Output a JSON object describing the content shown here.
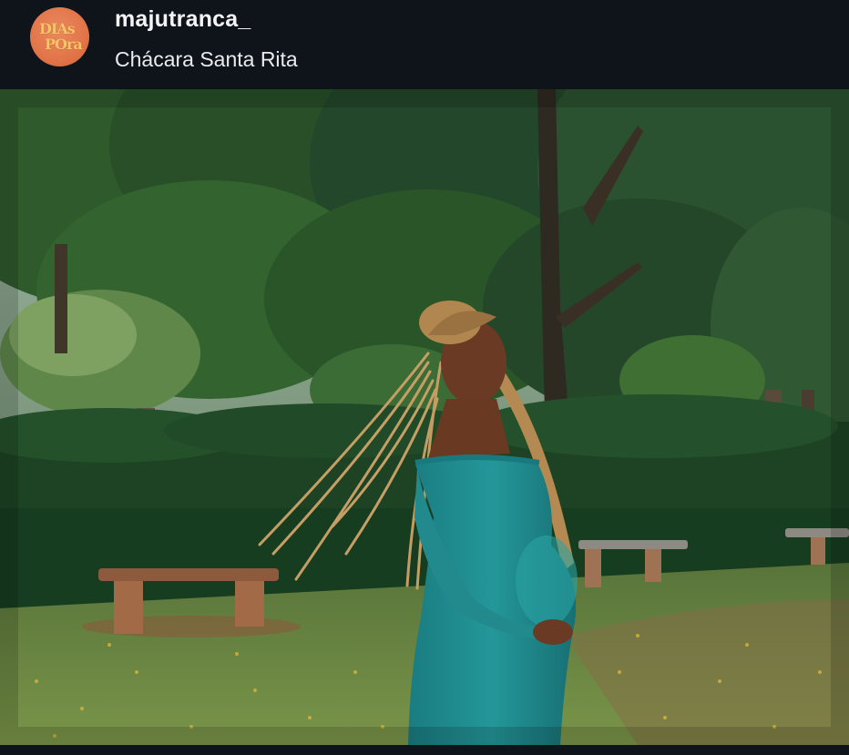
{
  "post": {
    "username": "majutranca_",
    "location": "Chácara Santa Rita",
    "avatar_logo": {
      "line1": "DIAs",
      "line2": "POra"
    }
  },
  "colors": {
    "header_bg": "#0f141a",
    "avatar_bg": "#e27449",
    "dress": "#1f8e92",
    "foliage": "#2e5a2f",
    "grass": "#6d8a43"
  },
  "icons": {
    "avatar": "profile-avatar-icon"
  }
}
